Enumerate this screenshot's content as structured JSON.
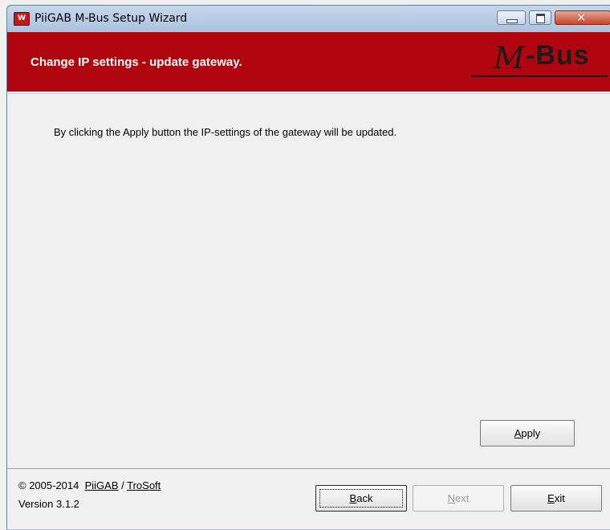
{
  "window": {
    "title": "PiiGAB M-Bus Setup Wizard",
    "app_icon_letter": "W",
    "controls": {
      "close_glyph": "✕"
    }
  },
  "header": {
    "title": "Change IP settings - update gateway.",
    "logo_text": "-Bus",
    "logo_m": "M"
  },
  "content": {
    "info_text": "By clicking the Apply button the IP-settings of the gateway will be updated."
  },
  "buttons": {
    "apply": {
      "mnemonic": "A",
      "rest": "pply"
    },
    "back": {
      "mnemonic": "B",
      "rest": "ack"
    },
    "next": {
      "mnemonic": "N",
      "rest": "ext"
    },
    "exit": {
      "mnemonic": "E",
      "rest": "xit"
    }
  },
  "footer": {
    "copyright": "© 2005-2014",
    "link1": "PiiGAB",
    "separator": "/",
    "link2": "TroSoft",
    "version": "Version 3.1.2"
  },
  "colors": {
    "header_bg": "#b0050f",
    "header_text": "#ffffff"
  }
}
